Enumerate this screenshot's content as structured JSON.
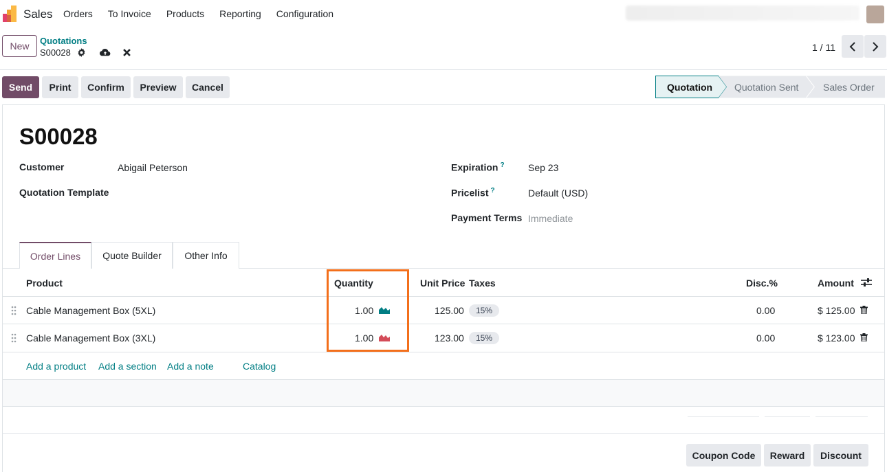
{
  "navbar": {
    "app_name": "Sales",
    "menu": [
      "Orders",
      "To Invoice",
      "Products",
      "Reporting",
      "Configuration"
    ]
  },
  "control": {
    "new_label": "New",
    "breadcrumb_parent": "Quotations",
    "record_name": "S00028",
    "pager": "1 / 11"
  },
  "actions": {
    "send": "Send",
    "print": "Print",
    "confirm": "Confirm",
    "preview": "Preview",
    "cancel": "Cancel"
  },
  "status": {
    "steps": [
      "Quotation",
      "Quotation Sent",
      "Sales Order"
    ],
    "active": "Quotation"
  },
  "form": {
    "title": "S00028",
    "customer_label": "Customer",
    "customer_value": "Abigail Peterson",
    "template_label": "Quotation Template",
    "expiration_label": "Expiration",
    "expiration_value": "Sep 23",
    "pricelist_label": "Pricelist",
    "pricelist_value": "Default (USD)",
    "payment_terms_label": "Payment Terms",
    "payment_terms_placeholder": "Immediate",
    "help_mark": "?"
  },
  "tabs": [
    "Order Lines",
    "Quote Builder",
    "Other Info"
  ],
  "table": {
    "headers": {
      "product": "Product",
      "quantity": "Quantity",
      "unit_price": "Unit Price",
      "taxes": "Taxes",
      "disc": "Disc.%",
      "amount": "Amount"
    },
    "rows": [
      {
        "product": "Cable Management Box (5XL)",
        "quantity": "1.00",
        "unit_price": "125.00",
        "tax": "15%",
        "disc": "0.00",
        "amount": "$ 125.00",
        "forecast_color": "#017e84"
      },
      {
        "product": "Cable Management Box (3XL)",
        "quantity": "1.00",
        "unit_price": "123.00",
        "tax": "15%",
        "disc": "0.00",
        "amount": "$ 123.00",
        "forecast_color": "#d44c59"
      }
    ],
    "links": {
      "add_product": "Add a product",
      "add_section": "Add a section",
      "add_note": "Add a note",
      "catalog": "Catalog"
    }
  },
  "bottom": {
    "coupon": "Coupon Code",
    "reward": "Reward",
    "discount": "Discount"
  },
  "colors": {
    "brand": "#714b67",
    "link": "#017e84",
    "highlight": "#f36f1b"
  }
}
